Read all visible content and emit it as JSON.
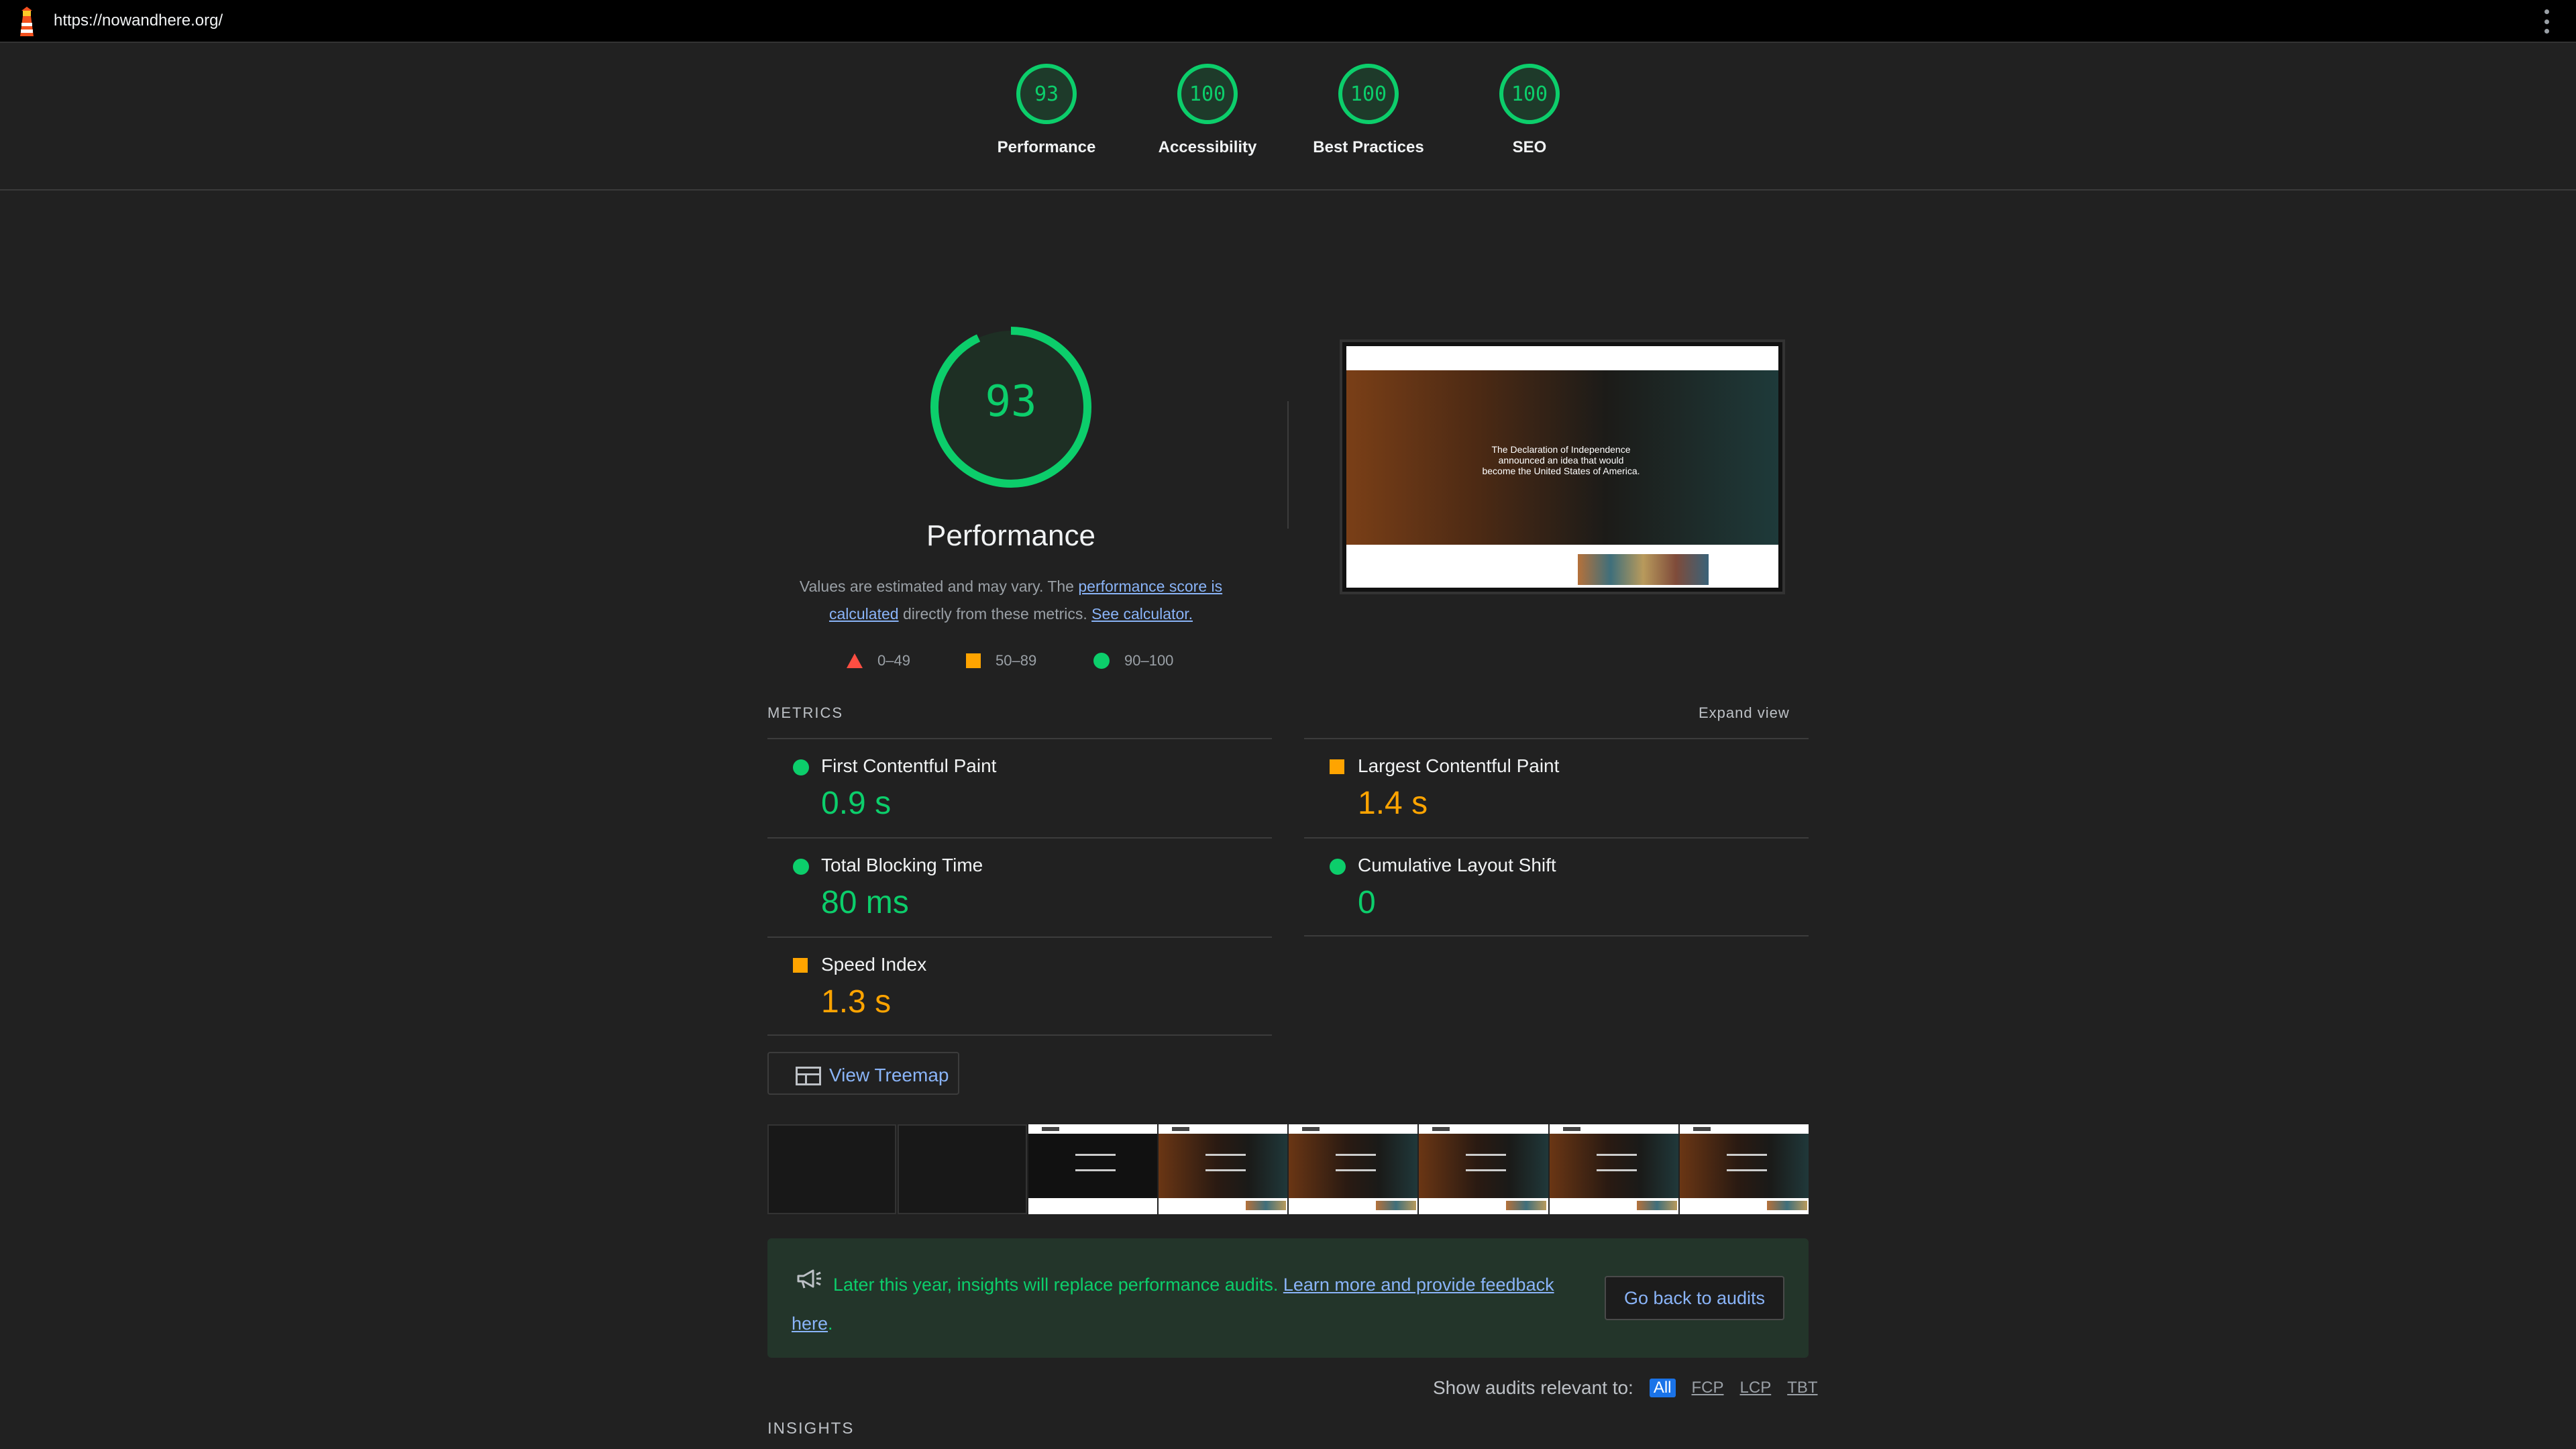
{
  "url": "https://nowandhere.org/",
  "scores": [
    {
      "label": "Performance",
      "value": "93"
    },
    {
      "label": "Accessibility",
      "value": "100"
    },
    {
      "label": "Best Practices",
      "value": "100"
    },
    {
      "label": "SEO",
      "value": "100"
    }
  ],
  "performance": {
    "score": "93",
    "title": "Performance",
    "desc_pre": "Values are estimated and may vary. The ",
    "desc_link1": "performance score is calculated",
    "desc_mid": " directly from these metrics. ",
    "desc_link2": "See calculator."
  },
  "legend": [
    {
      "range": "0–49",
      "color": "#ff4e42"
    },
    {
      "range": "50–89",
      "color": "#ffa400"
    },
    {
      "range": "90–100",
      "color": "#0cce6b"
    }
  ],
  "screenshot": {
    "hero_text": "The Declaration of Independence announced an idea that would become the United States of America."
  },
  "metrics": {
    "heading": "METRICS",
    "expand": "Expand view",
    "items": [
      {
        "name": "First Contentful Paint",
        "value": "0.9 s",
        "status": "good"
      },
      {
        "name": "Largest Contentful Paint",
        "value": "1.4 s",
        "status": "average"
      },
      {
        "name": "Total Blocking Time",
        "value": "80 ms",
        "status": "good"
      },
      {
        "name": "Cumulative Layout Shift",
        "value": "0",
        "status": "good"
      },
      {
        "name": "Speed Index",
        "value": "1.3 s",
        "status": "average"
      }
    ]
  },
  "treemap_label": "View Treemap",
  "banner": {
    "text": "Later this year, insights will replace performance audits. ",
    "link": "Learn more and provide feedback here",
    "end": ".",
    "button": "Go back to audits"
  },
  "filter": {
    "label": "Show audits relevant to:",
    "options": [
      "All",
      "FCP",
      "LCP",
      "TBT"
    ],
    "active": "All"
  },
  "insights_heading": "INSIGHTS",
  "colors": {
    "good": "#0cce6b",
    "average": "#ffa400",
    "poor": "#ff4e42",
    "link": "#8ab4f8"
  }
}
